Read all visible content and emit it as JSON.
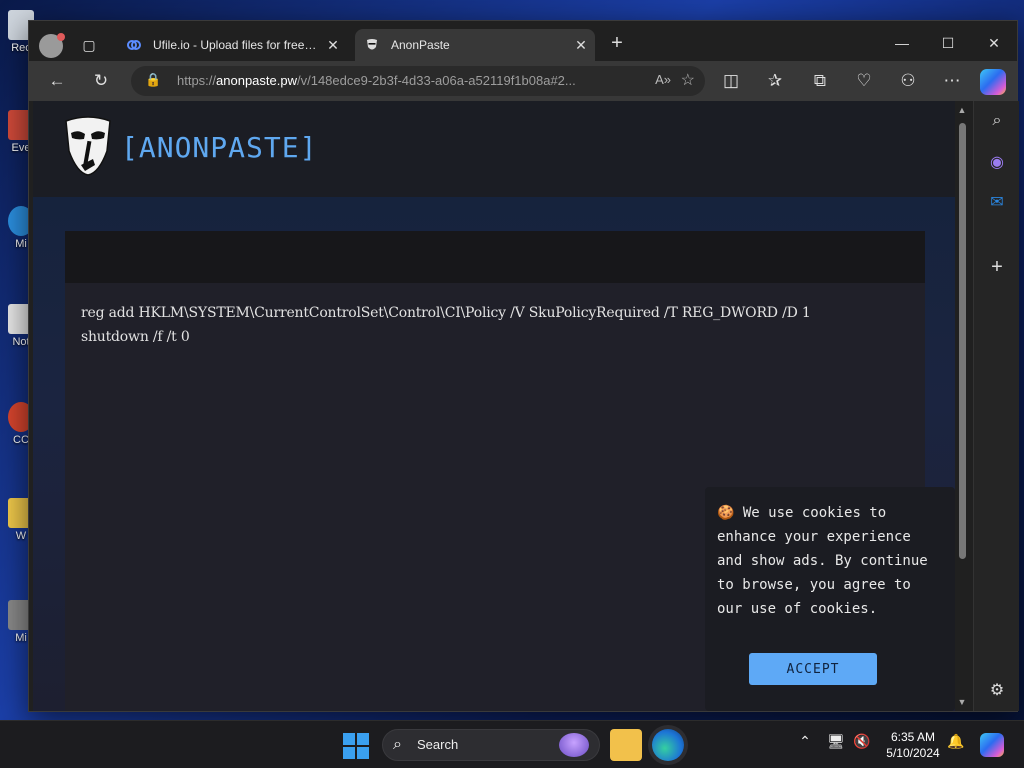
{
  "desktop": {
    "icons": [
      {
        "label": "Rec",
        "color": "#cfd6de"
      },
      {
        "label": "Eve",
        "color": "#d04a3a"
      },
      {
        "label": "Mi",
        "color": "#2b8fe0"
      },
      {
        "label": "Not",
        "color": "#e8e8e8"
      },
      {
        "label": "CC",
        "color": "#d8452e"
      },
      {
        "label": "W",
        "color": "#f0c94b"
      },
      {
        "label": "Mi",
        "color": "#8a8a8a"
      }
    ]
  },
  "browser": {
    "tabs": [
      {
        "title": "Ufile.io - Upload files for free & s",
        "active": false
      },
      {
        "title": "AnonPaste",
        "active": true
      }
    ],
    "tab_close": "✕",
    "new_tab": "+",
    "window_controls": {
      "minimize": "—",
      "maximize": "☐",
      "close": "✕"
    },
    "address": {
      "scheme": "https://",
      "host": "anonpaste.pw",
      "path": "/v/148edce9-2b3f-4d33-a06a-a52119f1b08a#2...",
      "read_aloud": "A»"
    }
  },
  "page": {
    "brand": "[ANONPASTE]",
    "paste_lines": [
      "reg add HKLM\\SYSTEM\\CurrentControlSet\\Control\\CI\\Policy /V SkuPolicyRequired /T REG_DWORD /D 1",
      "shutdown /f /t 0"
    ],
    "cookie": {
      "emoji": "🍪",
      "text": "We use cookies to enhance your experience and show ads. By continue to browse, you agree to our use of cookies.",
      "accept_label": "ACCEPT"
    }
  },
  "taskbar": {
    "search_label": "Search",
    "time": "6:35 AM",
    "date": "5/10/2024"
  },
  "colors": {
    "brand_blue": "#5fa8f0",
    "accept_button": "#5ea9f6",
    "page_background": "#1a1d2a"
  }
}
